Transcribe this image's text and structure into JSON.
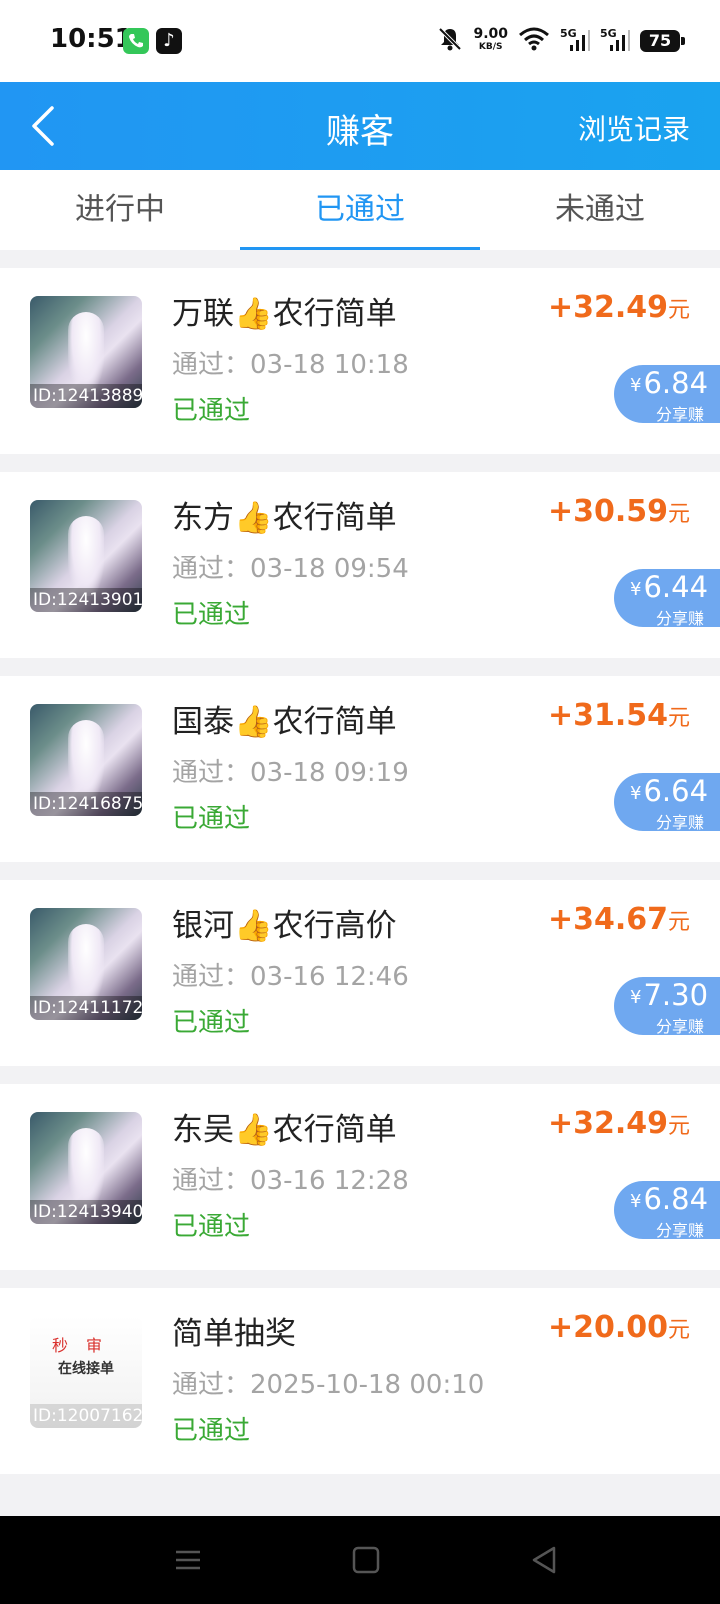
{
  "status_bar": {
    "time": "10:51",
    "net_speed": "9.00",
    "net_speed_unit": "KB/S",
    "sim1": "5G",
    "sim2": "5G",
    "battery": "75"
  },
  "header": {
    "title": "赚客",
    "history_label": "浏览记录",
    "color": "#2196f3"
  },
  "tabs": [
    {
      "label": "进行中",
      "active": false
    },
    {
      "label": "已通过",
      "active": true
    },
    {
      "label": "未通过",
      "active": false
    }
  ],
  "items": [
    {
      "name": "万联👍农行简单",
      "time": "通过：03-18 10:18",
      "status": "已通过",
      "amount": "+32.49",
      "unit": "元",
      "id": "ID:12413889",
      "share_value": "6.84",
      "share_label": "分享赚"
    },
    {
      "name": "东方👍农行简单",
      "time": "通过：03-18 09:54",
      "status": "已通过",
      "amount": "+30.59",
      "unit": "元",
      "id": "ID:12413901",
      "share_value": "6.44",
      "share_label": "分享赚"
    },
    {
      "name": "国泰👍农行简单",
      "time": "通过：03-18 09:19",
      "status": "已通过",
      "amount": "+31.54",
      "unit": "元",
      "id": "ID:12416875",
      "share_value": "6.64",
      "share_label": "分享赚"
    },
    {
      "name": "银河👍农行高价",
      "time": "通过：03-16 12:46",
      "status": "已通过",
      "amount": "+34.67",
      "unit": "元",
      "id": "ID:12411172",
      "share_value": "7.30",
      "share_label": "分享赚"
    },
    {
      "name": "东吴👍农行简单",
      "time": "通过：03-16 12:28",
      "status": "已通过",
      "amount": "+32.49",
      "unit": "元",
      "id": "ID:12413940",
      "share_value": "6.84",
      "share_label": "分享赚"
    },
    {
      "name": "简单抽奖",
      "time": "通过：2025-10-18 00:10",
      "status": "已通过",
      "amount": "+20.00",
      "unit": "元",
      "id": "ID:12007162",
      "promo_line1": "秒审",
      "promo_line2": "在线接单"
    }
  ],
  "currency_symbol": "¥",
  "colors": {
    "amount": "#f06a1b",
    "status_pass": "#3aa935",
    "share_badge": "#6fa8f0"
  }
}
